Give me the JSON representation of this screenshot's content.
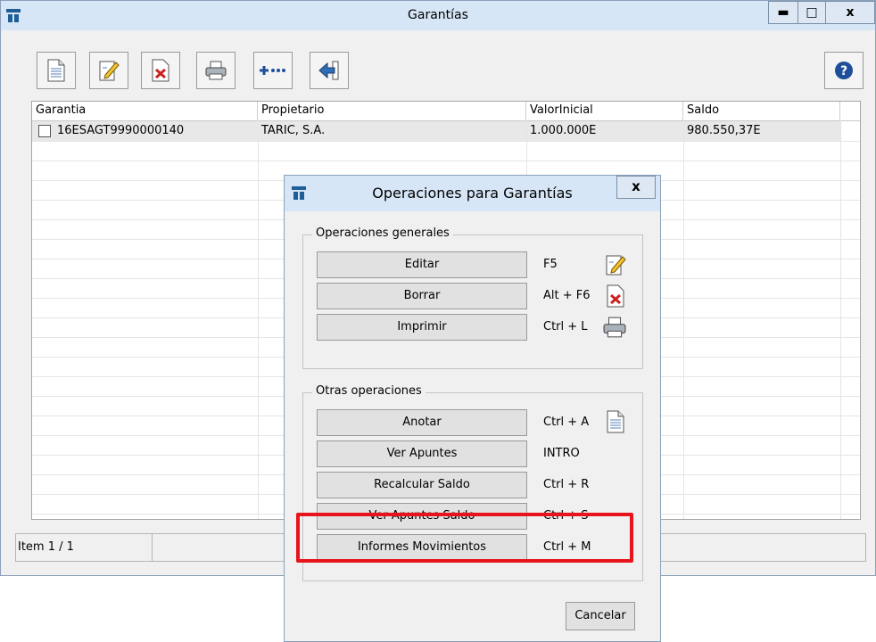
{
  "window": {
    "title": "Garantías",
    "minimize_glyph": "▬",
    "maximize_glyph": "□",
    "close_glyph": "x"
  },
  "toolbar": {
    "buttons": [
      {
        "name": "new-document-icon"
      },
      {
        "name": "edit-icon"
      },
      {
        "name": "delete-icon"
      },
      {
        "name": "print-icon"
      },
      {
        "name": "more-icon"
      },
      {
        "name": "back-icon"
      }
    ],
    "help_icon": "help-icon"
  },
  "grid": {
    "columns": [
      "Garantia",
      "Propietario",
      "ValorInicial",
      "Saldo"
    ],
    "rows": [
      {
        "garantia": "16ESAGT9990000140",
        "propietario": "TARIC, S.A.",
        "valor_inicial": "1.000.000E",
        "saldo": "980.550,37E"
      }
    ]
  },
  "status_bar": {
    "item": "Item 1 / 1"
  },
  "dialog": {
    "title": "Operaciones para Garantías",
    "close_glyph": "x",
    "group_general": {
      "label": "Operaciones generales",
      "buttons": [
        {
          "label": "Editar",
          "shortcut": "F5",
          "icon": "edit-icon"
        },
        {
          "label": "Borrar",
          "shortcut": "Alt + F6",
          "icon": "delete-icon"
        },
        {
          "label": "Imprimir",
          "shortcut": "Ctrl + L",
          "icon": "print-icon"
        }
      ]
    },
    "group_other": {
      "label": "Otras operaciones",
      "buttons": [
        {
          "label": "Anotar",
          "shortcut": "Ctrl + A",
          "icon": "new-document-icon"
        },
        {
          "label": "Ver Apuntes",
          "shortcut": "INTRO"
        },
        {
          "label": "Recalcular Saldo",
          "shortcut": "Ctrl + R"
        },
        {
          "label": "Ver Apuntes Saldo",
          "shortcut": "Ctrl + S"
        },
        {
          "label": "Informes Movimientos",
          "shortcut": "Ctrl + M"
        }
      ]
    },
    "cancel_label": "Cancelar"
  },
  "colors": {
    "titlebar": "#d6e6f6",
    "accent": "#1f5f99",
    "highlight": "#e8141b",
    "selected_row": "#e8e8e8"
  }
}
